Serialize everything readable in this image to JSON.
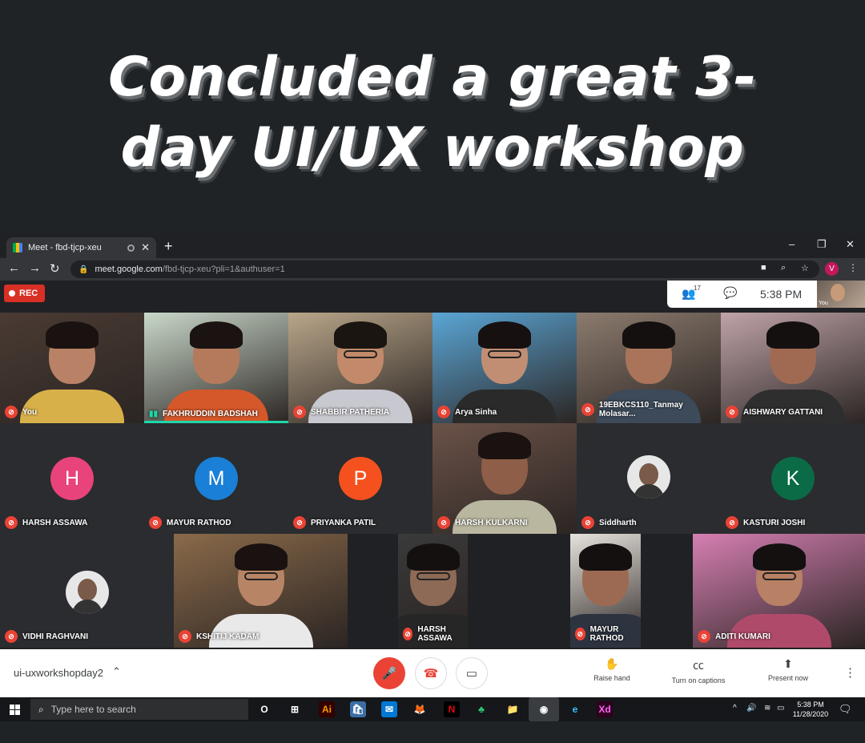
{
  "banner": {
    "title": "Concluded a great 3-day UI/UX workshop"
  },
  "browser": {
    "tab_title": "Meet - fbd-tjcp-xeu",
    "tab_close": "✕",
    "new_tab": "+",
    "url_host": "meet.google.com",
    "url_path": "/fbd-tjcp-xeu?pli=1&authuser=1",
    "profile_initial": "V",
    "window_controls": {
      "minimize": "–",
      "maximize": "❐",
      "close": "✕"
    },
    "nav": {
      "back": "←",
      "forward": "→",
      "reload": "↻"
    }
  },
  "meet": {
    "rec_label": "REC",
    "participant_count": "17",
    "time": "5:38 PM",
    "self_label": "You",
    "tiles": [
      {
        "name": "You",
        "mic": "off",
        "kind": "video",
        "bg": "#4a3b33",
        "skin": "#b98266",
        "hair": "#1a1210",
        "body": "#d8b04a",
        "glasses": false
      },
      {
        "name": "FAKHRUDDIN BADSHAH",
        "mic": "on",
        "kind": "video",
        "bg": "#c9d8c9",
        "skin": "#b57a5c",
        "hair": "#1a1311",
        "body": "#d4582a",
        "glasses": false,
        "speaking": true
      },
      {
        "name": "SHABBIR PATHERIA",
        "mic": "off",
        "kind": "video",
        "bg": "#b9a68a",
        "skin": "#c28a6a",
        "hair": "#1b1512",
        "body": "#c8c8d0",
        "glasses": true
      },
      {
        "name": "Arya Sinha",
        "mic": "off",
        "kind": "video",
        "bg": "#5aa6d6",
        "skin": "#c18e74",
        "hair": "#161010",
        "body": "#2a2a2a",
        "glasses": true
      },
      {
        "name": "19EBKCS110_Tanmay Molasar...",
        "mic": "off",
        "kind": "video",
        "bg": "#8c7b6e",
        "skin": "#a9745a",
        "hair": "#141010",
        "body": "#3c4a5a",
        "glasses": false
      },
      {
        "name": "AISHWARY GATTANI",
        "mic": "off",
        "kind": "video",
        "bg": "#bfa3a8",
        "skin": "#a06a52",
        "hair": "#141010",
        "body": "#2e2e2e",
        "glasses": false
      },
      {
        "name": "HARSH ASSAWA",
        "mic": "off",
        "kind": "initial",
        "initial": "H",
        "color": "#e8437a"
      },
      {
        "name": "MAYUR RATHOD",
        "mic": "off",
        "kind": "initial",
        "initial": "M",
        "color": "#1a7fd6"
      },
      {
        "name": "PRIYANKA PATIL",
        "mic": "off",
        "kind": "initial",
        "initial": "P",
        "color": "#f4511e"
      },
      {
        "name": "HARSH KULKARNI",
        "mic": "off",
        "kind": "video",
        "bg": "#6b5248",
        "skin": "#8e5e48",
        "hair": "#1a1210",
        "body": "#b9b7a0",
        "glasses": false
      },
      {
        "name": "Siddharth",
        "mic": "off",
        "kind": "photo"
      },
      {
        "name": "KASTURI JOSHI",
        "mic": "off",
        "kind": "initial",
        "initial": "K",
        "color": "#0b6b46"
      },
      {
        "name": "VIDHI RAGHVANI",
        "mic": "off",
        "kind": "photo"
      },
      {
        "name": "KSHITIJ KADAM",
        "mic": "off",
        "kind": "video",
        "bg": "#8a6a4a",
        "skin": "#b88466",
        "hair": "#1a1210",
        "body": "#e9e9e9",
        "glasses": true
      },
      {
        "name": "HARSH ASSAWA",
        "mic": "off",
        "kind": "video",
        "bg": "#3a3a3a",
        "skin": "#8d6a55",
        "hair": "#151010",
        "body": "#262626",
        "glasses": true
      },
      {
        "name": "MAYUR RATHOD",
        "mic": "off",
        "kind": "video",
        "bg": "#e6e2dc",
        "skin": "#9c6a52",
        "hair": "#151010",
        "body": "#2d3440",
        "glasses": false
      },
      {
        "name": "ADITI KUMARI",
        "mic": "off",
        "kind": "video",
        "bg": "#d67fb2",
        "skin": "#b88064",
        "hair": "#141010",
        "body": "#b04a6a",
        "glasses": true
      }
    ],
    "bottom": {
      "meeting_code": "ui-uxworkshopday2",
      "chevron": "^",
      "raise_hand": "Raise hand",
      "captions": "Turn on captions",
      "present": "Present now"
    }
  },
  "taskbar": {
    "search_placeholder": "Type here to search",
    "apps": [
      "O",
      "⊞",
      "Ai",
      "🛍",
      "✉",
      "🦊",
      "N",
      "♣",
      "📁",
      "◉",
      "e",
      "Xd"
    ],
    "time": "5:38 PM",
    "date": "11/28/2020"
  }
}
